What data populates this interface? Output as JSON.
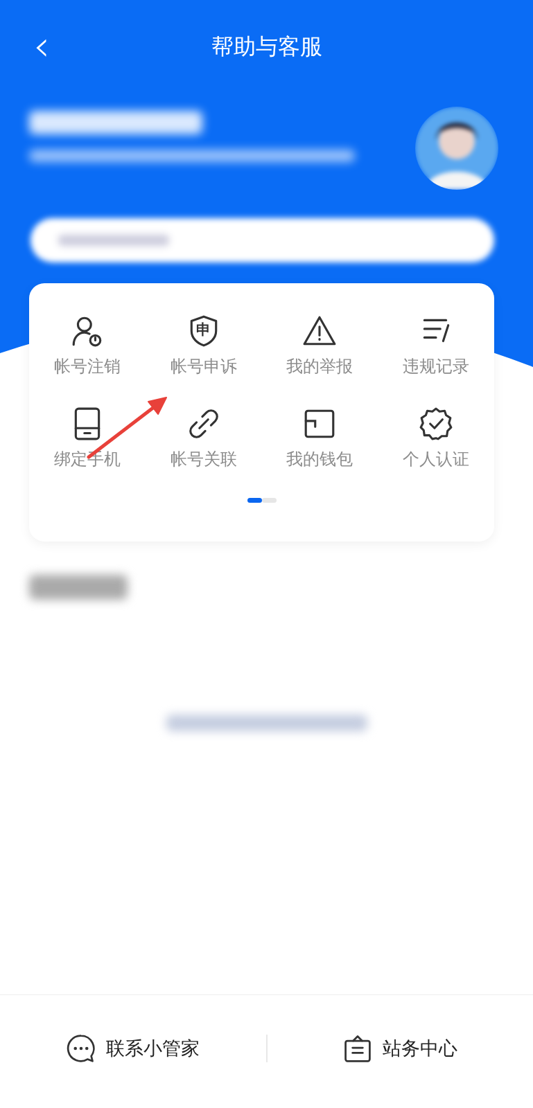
{
  "header": {
    "back_icon": "‹",
    "title": "帮助与客服"
  },
  "menu": [
    {
      "label": "帐号注销"
    },
    {
      "label": "帐号申诉",
      "icon_text": "申"
    },
    {
      "label": "我的举报"
    },
    {
      "label": "违规记录"
    },
    {
      "label": "绑定手机"
    },
    {
      "label": "帐号关联"
    },
    {
      "label": "我的钱包"
    },
    {
      "label": "个人认证"
    }
  ],
  "pager": [
    {
      "selected": true
    },
    {
      "selected": false
    }
  ],
  "bottom_bar": [
    {
      "label": "联系小管家"
    },
    {
      "label": "站务中心"
    }
  ]
}
